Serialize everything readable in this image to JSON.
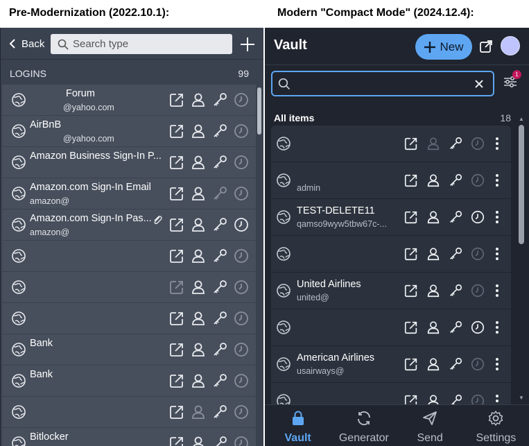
{
  "captions": {
    "left": "Pre-Modernization (2022.10.1):",
    "right": "Modern \"Compact Mode\" (2024.12.4):"
  },
  "old": {
    "back_label": "Back",
    "search_placeholder": "Search type",
    "section_label": "LOGINS",
    "section_count": "99",
    "rows": [
      {
        "name": "Forum",
        "sub": "@yahoo.com",
        "name_indent": true,
        "clip": true
      },
      {
        "name": "AirBnB",
        "sub": "@yahoo.com",
        "sub_indent": true
      },
      {
        "name": "Amazon Business Sign-In P...",
        "sub": ""
      },
      {
        "name": "Amazon.com Sign-In Email",
        "sub": "amazon@"
      },
      {
        "name": "Amazon.com Sign-In Pas...",
        "sub": "amazon@",
        "attachment": true
      },
      {
        "name": "",
        "sub": ""
      },
      {
        "name": "",
        "sub": ""
      },
      {
        "name": "",
        "sub": ""
      },
      {
        "name": "Bank",
        "sub": ""
      },
      {
        "name": "Bank",
        "sub": ""
      },
      {
        "name": "",
        "sub": ""
      },
      {
        "name": "Bitlocker",
        "sub": ""
      }
    ]
  },
  "new": {
    "title": "Vault",
    "new_button": "New",
    "search_value": "",
    "filter_badge": "1",
    "section_label": "All items",
    "section_count": "18",
    "rows": [
      {
        "name": "",
        "sub": ""
      },
      {
        "name": "",
        "sub": "admin"
      },
      {
        "name": "TEST-DELETE11",
        "sub": "qamso9wyw5tbw67c-..."
      },
      {
        "name": "",
        "sub": ""
      },
      {
        "name": "United Airlines",
        "sub": "united@"
      },
      {
        "name": "",
        "sub": ""
      },
      {
        "name": "American Airlines",
        "sub": "usairways@"
      },
      {
        "name": "",
        "sub": ""
      }
    ],
    "nav": [
      {
        "label": "Vault",
        "icon": "lock-icon",
        "active": true
      },
      {
        "label": "Generator",
        "icon": "refresh-icon",
        "active": false
      },
      {
        "label": "Send",
        "icon": "send-icon",
        "active": false
      },
      {
        "label": "Settings",
        "icon": "gear-icon",
        "active": false
      }
    ],
    "accent": "#5ea6f2"
  }
}
